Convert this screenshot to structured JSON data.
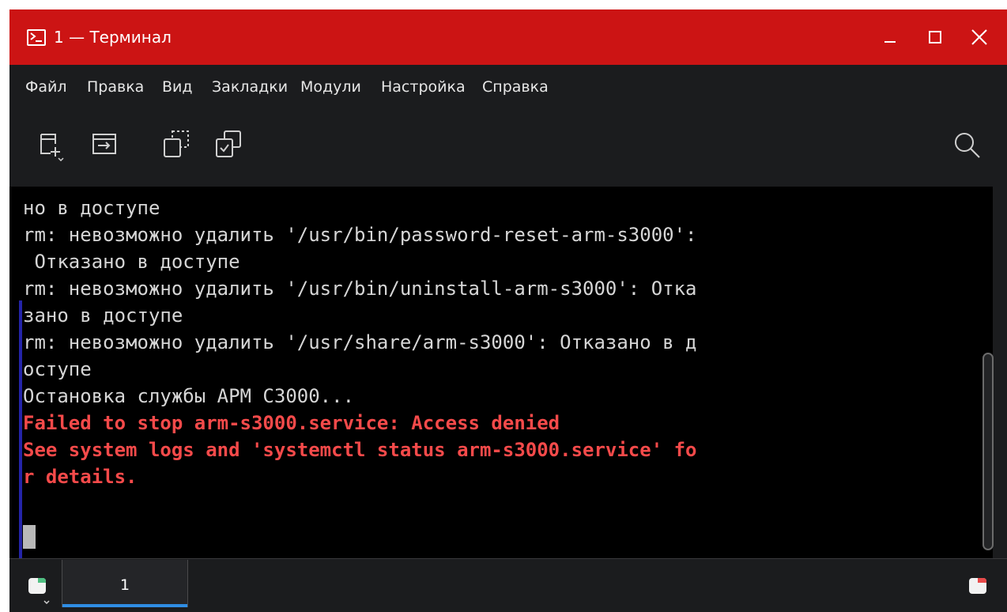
{
  "window": {
    "title": "1 — Терминал"
  },
  "menu": {
    "items": [
      "Файл",
      "Правка",
      "Вид",
      "Закладки",
      "Модули",
      "Настройка",
      "Справка"
    ]
  },
  "toolbar": {
    "icons": [
      "new-tab-icon",
      "split-view-icon",
      "detach-tab-icon",
      "copy-input-icon",
      "search-icon"
    ]
  },
  "terminal": {
    "lines": [
      {
        "text": "но в доступе",
        "style": "normal"
      },
      {
        "text": "rm: невозможно удалить '/usr/bin/password-reset-arm-s3000':",
        "style": "normal"
      },
      {
        "text": " Отказано в доступе",
        "style": "normal"
      },
      {
        "text": "rm: невозможно удалить '/usr/bin/uninstall-arm-s3000': Отка",
        "style": "normal"
      },
      {
        "text": "зано в доступе",
        "style": "normal"
      },
      {
        "text": "rm: невозможно удалить '/usr/share/arm-s3000': Отказано в д",
        "style": "normal"
      },
      {
        "text": "оступе",
        "style": "normal"
      },
      {
        "text": "Остановка службы АРМ С3000...",
        "style": "normal"
      },
      {
        "text": "Failed to stop arm-s3000.service: Access denied",
        "style": "error"
      },
      {
        "text": "See system logs and 'systemctl status arm-s3000.service' fo",
        "style": "error"
      },
      {
        "text": "r details.",
        "style": "error"
      }
    ]
  },
  "tabs": {
    "items": [
      {
        "label": "1",
        "active": true
      }
    ]
  },
  "colors": {
    "titlebar": "#cc1414",
    "background": "#1b1c1e",
    "terminal_bg": "#000000",
    "terminal_fg": "#d6d6d6",
    "error_fg": "#f54a4a",
    "tab_accent": "#2f8de4"
  }
}
